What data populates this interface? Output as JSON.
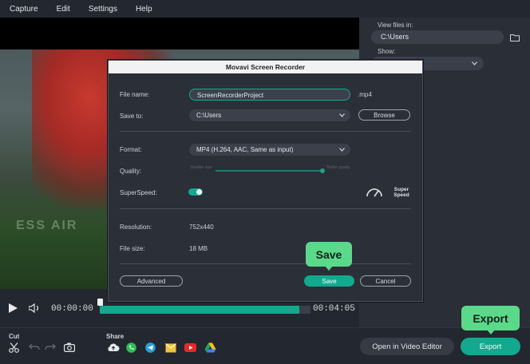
{
  "menu": {
    "items": [
      "Capture",
      "Edit",
      "Settings",
      "Help"
    ]
  },
  "right_panel": {
    "view_files_label": "View files in:",
    "view_files_value": "C:\\Users",
    "show_label": "Show:",
    "show_value": ""
  },
  "dialog": {
    "title": "Movavi Screen Recorder",
    "file_name_label": "File name:",
    "file_name_value": "ScreenRecorderProject",
    "file_ext": ".mp4",
    "save_to_label": "Save to:",
    "save_to_value": "C:\\Users",
    "browse_label": "Browse",
    "format_label": "Format:",
    "format_value": "MP4 (H.264, AAC, Same as input)",
    "quality_label": "Quality:",
    "quality_min_label": "Smaller size",
    "quality_max_label": "Better quality",
    "quality_level": 1.0,
    "superspeed_label": "SuperSpeed:",
    "superspeed_on": true,
    "superspeed_badge": "Super Speed",
    "resolution_label": "Resolution:",
    "resolution_value": "752x440",
    "file_size_label": "File size:",
    "file_size_value": "18 MB",
    "advanced_label": "Advanced",
    "save_label": "Save",
    "cancel_label": "Cancel"
  },
  "tooltips": {
    "save": "Save",
    "export": "Export"
  },
  "player": {
    "current_time": "00:00:00",
    "end_time": "00:04:05",
    "progress": 0.95
  },
  "bottom": {
    "cut_label": "Cut",
    "share_label": "Share",
    "open_editor_label": "Open in Video Editor",
    "export_label": "Export"
  },
  "colors": {
    "accent": "#13a98f",
    "tooltip": "#5bd98a"
  }
}
